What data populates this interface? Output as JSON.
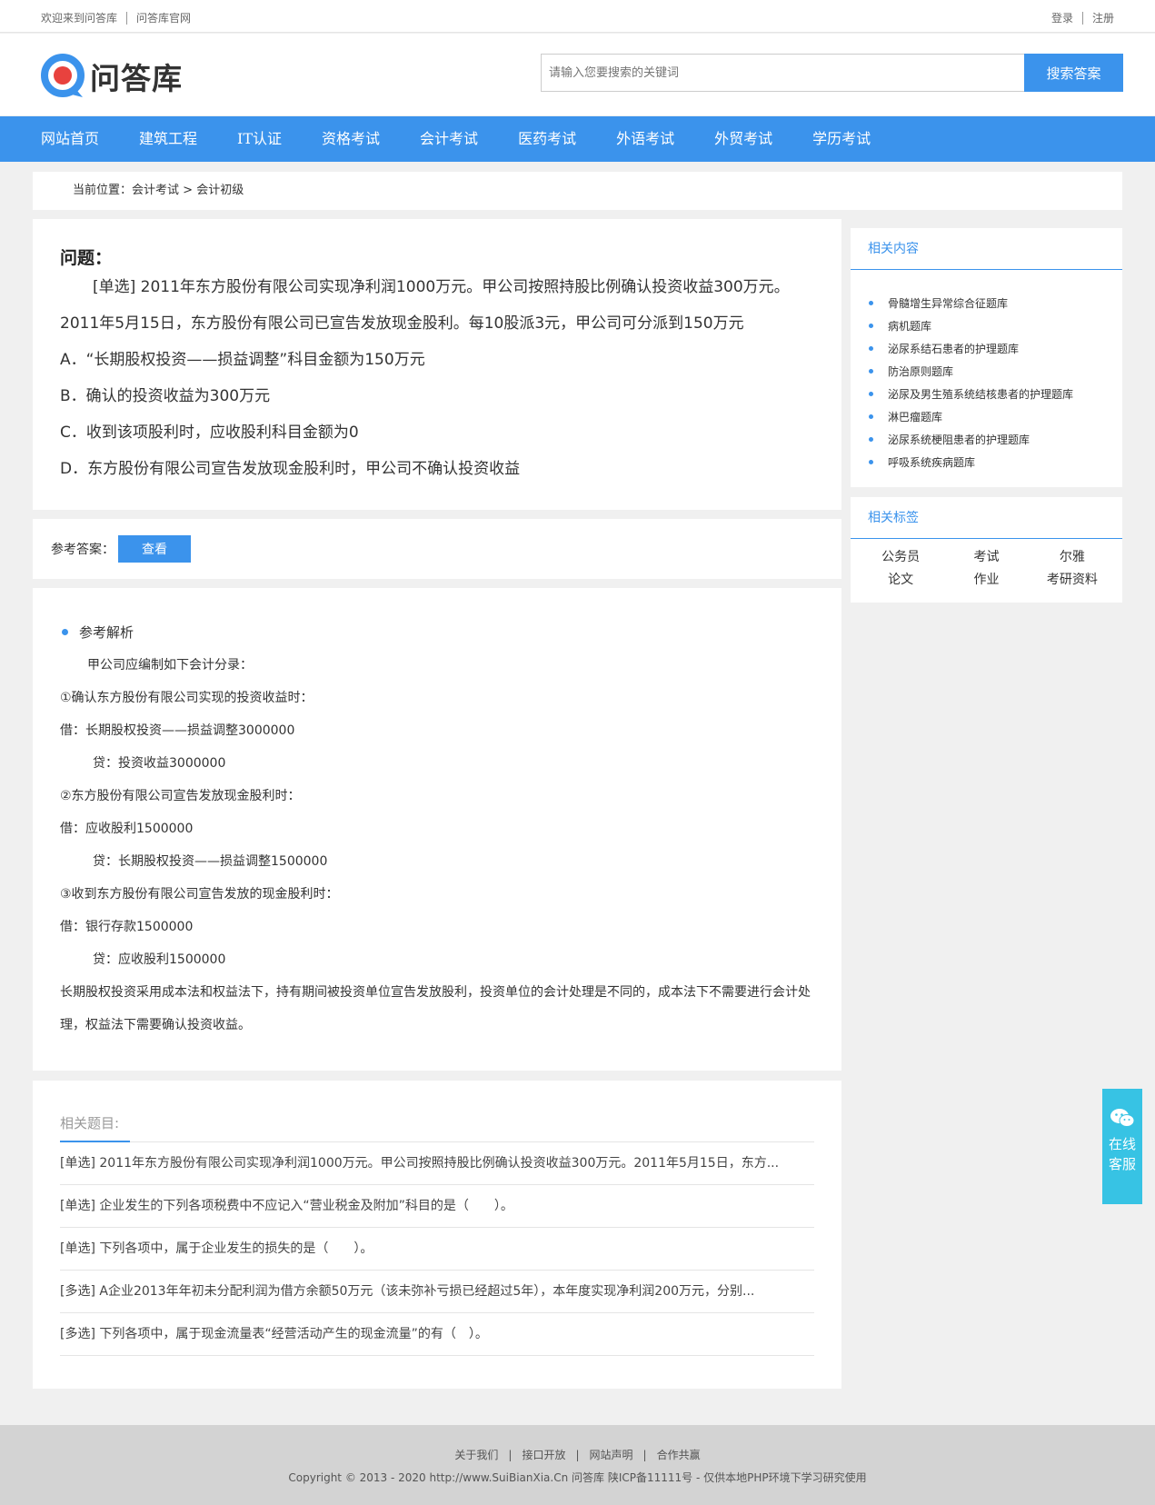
{
  "topbar": {
    "welcome": "欢迎来到问答库",
    "official": "问答库官网",
    "login": "登录",
    "register": "注册"
  },
  "header": {
    "logo_text": "问答库",
    "search_placeholder": "请输入您要搜索的关键词",
    "search_button": "搜索答案"
  },
  "nav": [
    "网站首页",
    "建筑工程",
    "IT认证",
    "资格考试",
    "会计考试",
    "医药考试",
    "外语考试",
    "外贸考试",
    "学历考试"
  ],
  "breadcrumb": {
    "prefix": "当前位置：",
    "level1": "会计考试",
    "arrow": " > ",
    "level2": "会计初级"
  },
  "question": {
    "title": "问题：",
    "text": "[单选] 2011年东方股份有限公司实现净利润1000万元。甲公司按照持股比例确认投资收益300万元。2011年5月15日，东方股份有限公司已宣告发放现金股利。每10股派3元，甲公司可分派到150万元",
    "options": [
      "A．“长期股权投资——损益调整”科目金额为150万元",
      "B．确认的投资收益为300万元",
      "C．收到该项股利时，应收股利科目金额为0",
      "D．东方股份有限公司宣告发放现金股利时，甲公司不确认投资收益"
    ]
  },
  "answer": {
    "label": "参考答案：",
    "button": "查看"
  },
  "explanation": {
    "heading": "参考解析",
    "lines": [
      "甲公司应编制如下会计分录：",
      "①确认东方股份有限公司实现的投资收益时：",
      "借：长期股权投资——损益调整3000000",
      "贷：投资收益3000000",
      "②东方股份有限公司宣告发放现金股利时：",
      "借：应收股利1500000",
      "贷：长期股权投资——损益调整1500000",
      "③收到东方股份有限公司宣告发放的现金股利时：",
      "借：银行存款1500000",
      "贷：应收股利1500000",
      "长期股权投资采用成本法和权益法下，持有期间被投资单位宣告发放股利，投资单位的会计处理是不同的，成本法下不需要进行会计处理，权益法下需要确认投资收益。"
    ]
  },
  "related": {
    "heading": "相关题目:",
    "items": [
      "[单选] 2011年东方股份有限公司实现净利润1000万元。甲公司按照持股比例确认投资收益300万元。2011年5月15日，东方...",
      "[单选] 企业发生的下列各项税费中不应记入“营业税金及附加”科目的是（　　）。",
      "[单选] 下列各项中，属于企业发生的损失的是（　　）。",
      "[多选] A企业2013年年初未分配利润为借方余额50万元（该未弥补亏损已经超过5年），本年度实现净利润200万元，分别...",
      "[多选] 下列各项中，属于现金流量表“经营活动产生的现金流量”的有（　）。"
    ]
  },
  "sidebar": {
    "related_content": {
      "heading": "相关内容",
      "items": [
        "骨髓增生异常综合征题库",
        "病机题库",
        "泌尿系结石患者的护理题库",
        "防治原则题库",
        "泌尿及男生殖系统结核患者的护理题库",
        "淋巴瘤题库",
        "泌尿系统梗阻患者的护理题库",
        "呼吸系统疾病题库"
      ]
    },
    "related_tags": {
      "heading": "相关标签",
      "items": [
        "公务员",
        "考试",
        "尔雅",
        "论文",
        "作业",
        "考研资料"
      ]
    }
  },
  "float_service": {
    "line1": "在线",
    "line2": "客服"
  },
  "footer": {
    "links": [
      "关于我们",
      "接口开放",
      "网站声明",
      "合作共赢"
    ],
    "copyright": "Copyright © 2013 - 2020 http://www.SuiBianXia.Cn  问答库   陕ICP备11111号 - 仅供本地PHP环境下学习研究使用"
  },
  "colors": {
    "accent": "#3b93ec",
    "service": "#37c3e4",
    "logo_red": "#e8423e"
  }
}
